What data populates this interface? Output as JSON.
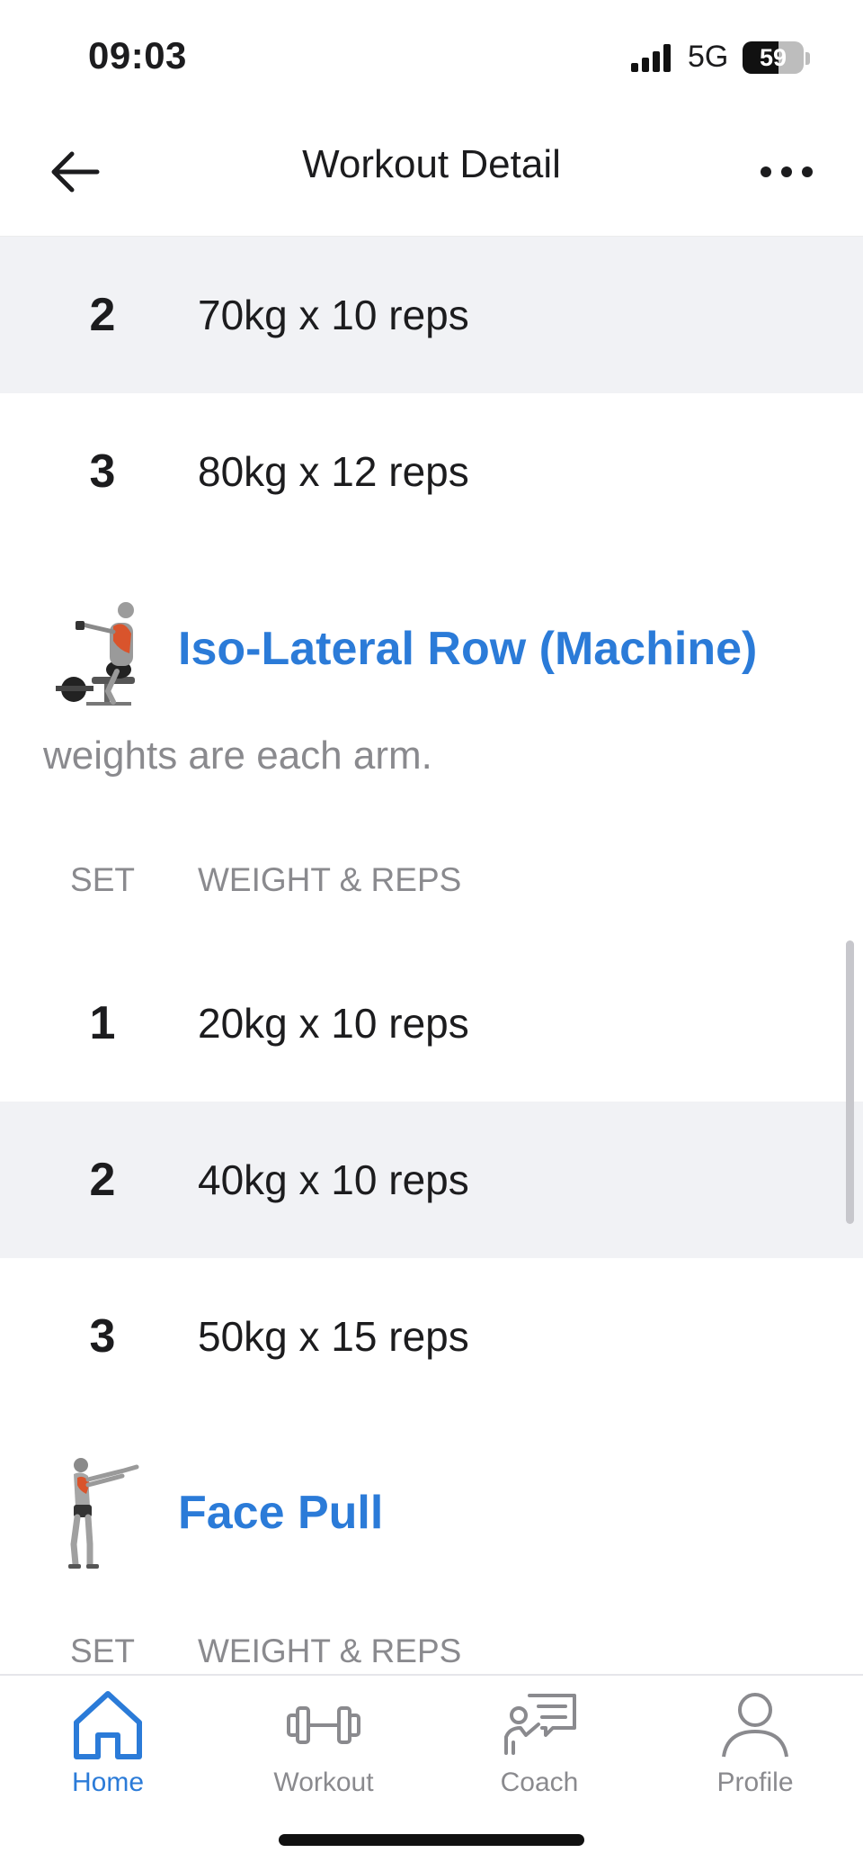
{
  "status_bar": {
    "time": "09:03",
    "network": "5G",
    "battery_level": "59",
    "battery_fraction": 0.59
  },
  "nav": {
    "title": "Workout Detail",
    "back_icon": "arrow-left-icon",
    "more_icon": "more-horizontal-icon"
  },
  "previous_exercise": {
    "sets": [
      {
        "set": "2",
        "detail": "70kg x 10 reps"
      },
      {
        "set": "3",
        "detail": "80kg x 12 reps"
      }
    ]
  },
  "exercises": [
    {
      "name": "Iso-Lateral Row (Machine)",
      "note": "weights are each arm.",
      "column_set": "SET",
      "column_weight": "WEIGHT & REPS",
      "sets": [
        {
          "set": "1",
          "detail": "20kg x 10 reps"
        },
        {
          "set": "2",
          "detail": "40kg x 10 reps"
        },
        {
          "set": "3",
          "detail": "50kg x 15 reps"
        }
      ]
    },
    {
      "name": "Face Pull",
      "column_set": "SET",
      "column_weight": "WEIGHT & REPS"
    }
  ],
  "tabs": [
    {
      "label": "Home",
      "icon": "home-icon",
      "active": true
    },
    {
      "label": "Workout",
      "icon": "dumbbell-icon",
      "active": false
    },
    {
      "label": "Coach",
      "icon": "coach-icon",
      "active": false
    },
    {
      "label": "Profile",
      "icon": "profile-icon",
      "active": false
    }
  ],
  "colors": {
    "accent": "#2b7bd8",
    "row_alt_bg": "#f1f2f5",
    "muted_text": "#8a8a8e"
  }
}
